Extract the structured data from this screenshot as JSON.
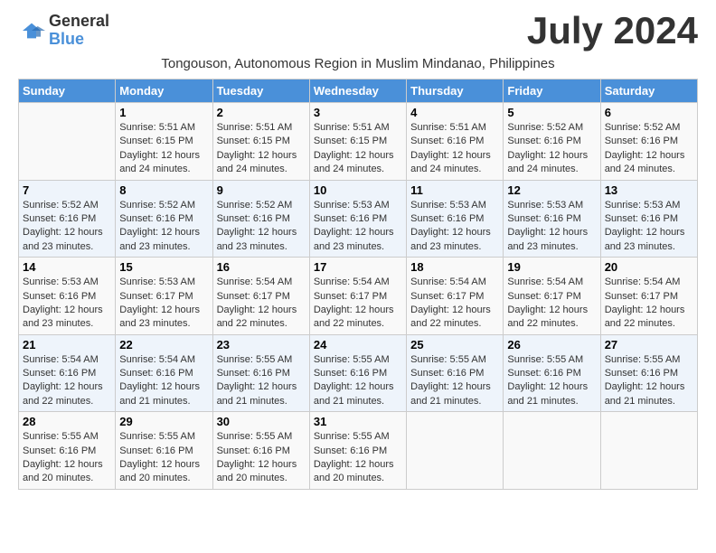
{
  "logo": {
    "line1": "General",
    "line2": "Blue"
  },
  "title": "July 2024",
  "subtitle": "Tongouson, Autonomous Region in Muslim Mindanao, Philippines",
  "days_of_week": [
    "Sunday",
    "Monday",
    "Tuesday",
    "Wednesday",
    "Thursday",
    "Friday",
    "Saturday"
  ],
  "weeks": [
    [
      {
        "num": "",
        "sunrise": "",
        "sunset": "",
        "daylight": ""
      },
      {
        "num": "1",
        "sunrise": "Sunrise: 5:51 AM",
        "sunset": "Sunset: 6:15 PM",
        "daylight": "Daylight: 12 hours and 24 minutes."
      },
      {
        "num": "2",
        "sunrise": "Sunrise: 5:51 AM",
        "sunset": "Sunset: 6:15 PM",
        "daylight": "Daylight: 12 hours and 24 minutes."
      },
      {
        "num": "3",
        "sunrise": "Sunrise: 5:51 AM",
        "sunset": "Sunset: 6:15 PM",
        "daylight": "Daylight: 12 hours and 24 minutes."
      },
      {
        "num": "4",
        "sunrise": "Sunrise: 5:51 AM",
        "sunset": "Sunset: 6:16 PM",
        "daylight": "Daylight: 12 hours and 24 minutes."
      },
      {
        "num": "5",
        "sunrise": "Sunrise: 5:52 AM",
        "sunset": "Sunset: 6:16 PM",
        "daylight": "Daylight: 12 hours and 24 minutes."
      },
      {
        "num": "6",
        "sunrise": "Sunrise: 5:52 AM",
        "sunset": "Sunset: 6:16 PM",
        "daylight": "Daylight: 12 hours and 24 minutes."
      }
    ],
    [
      {
        "num": "7",
        "sunrise": "Sunrise: 5:52 AM",
        "sunset": "Sunset: 6:16 PM",
        "daylight": "Daylight: 12 hours and 23 minutes."
      },
      {
        "num": "8",
        "sunrise": "Sunrise: 5:52 AM",
        "sunset": "Sunset: 6:16 PM",
        "daylight": "Daylight: 12 hours and 23 minutes."
      },
      {
        "num": "9",
        "sunrise": "Sunrise: 5:52 AM",
        "sunset": "Sunset: 6:16 PM",
        "daylight": "Daylight: 12 hours and 23 minutes."
      },
      {
        "num": "10",
        "sunrise": "Sunrise: 5:53 AM",
        "sunset": "Sunset: 6:16 PM",
        "daylight": "Daylight: 12 hours and 23 minutes."
      },
      {
        "num": "11",
        "sunrise": "Sunrise: 5:53 AM",
        "sunset": "Sunset: 6:16 PM",
        "daylight": "Daylight: 12 hours and 23 minutes."
      },
      {
        "num": "12",
        "sunrise": "Sunrise: 5:53 AM",
        "sunset": "Sunset: 6:16 PM",
        "daylight": "Daylight: 12 hours and 23 minutes."
      },
      {
        "num": "13",
        "sunrise": "Sunrise: 5:53 AM",
        "sunset": "Sunset: 6:16 PM",
        "daylight": "Daylight: 12 hours and 23 minutes."
      }
    ],
    [
      {
        "num": "14",
        "sunrise": "Sunrise: 5:53 AM",
        "sunset": "Sunset: 6:16 PM",
        "daylight": "Daylight: 12 hours and 23 minutes."
      },
      {
        "num": "15",
        "sunrise": "Sunrise: 5:53 AM",
        "sunset": "Sunset: 6:17 PM",
        "daylight": "Daylight: 12 hours and 23 minutes."
      },
      {
        "num": "16",
        "sunrise": "Sunrise: 5:54 AM",
        "sunset": "Sunset: 6:17 PM",
        "daylight": "Daylight: 12 hours and 22 minutes."
      },
      {
        "num": "17",
        "sunrise": "Sunrise: 5:54 AM",
        "sunset": "Sunset: 6:17 PM",
        "daylight": "Daylight: 12 hours and 22 minutes."
      },
      {
        "num": "18",
        "sunrise": "Sunrise: 5:54 AM",
        "sunset": "Sunset: 6:17 PM",
        "daylight": "Daylight: 12 hours and 22 minutes."
      },
      {
        "num": "19",
        "sunrise": "Sunrise: 5:54 AM",
        "sunset": "Sunset: 6:17 PM",
        "daylight": "Daylight: 12 hours and 22 minutes."
      },
      {
        "num": "20",
        "sunrise": "Sunrise: 5:54 AM",
        "sunset": "Sunset: 6:17 PM",
        "daylight": "Daylight: 12 hours and 22 minutes."
      }
    ],
    [
      {
        "num": "21",
        "sunrise": "Sunrise: 5:54 AM",
        "sunset": "Sunset: 6:16 PM",
        "daylight": "Daylight: 12 hours and 22 minutes."
      },
      {
        "num": "22",
        "sunrise": "Sunrise: 5:54 AM",
        "sunset": "Sunset: 6:16 PM",
        "daylight": "Daylight: 12 hours and 21 minutes."
      },
      {
        "num": "23",
        "sunrise": "Sunrise: 5:55 AM",
        "sunset": "Sunset: 6:16 PM",
        "daylight": "Daylight: 12 hours and 21 minutes."
      },
      {
        "num": "24",
        "sunrise": "Sunrise: 5:55 AM",
        "sunset": "Sunset: 6:16 PM",
        "daylight": "Daylight: 12 hours and 21 minutes."
      },
      {
        "num": "25",
        "sunrise": "Sunrise: 5:55 AM",
        "sunset": "Sunset: 6:16 PM",
        "daylight": "Daylight: 12 hours and 21 minutes."
      },
      {
        "num": "26",
        "sunrise": "Sunrise: 5:55 AM",
        "sunset": "Sunset: 6:16 PM",
        "daylight": "Daylight: 12 hours and 21 minutes."
      },
      {
        "num": "27",
        "sunrise": "Sunrise: 5:55 AM",
        "sunset": "Sunset: 6:16 PM",
        "daylight": "Daylight: 12 hours and 21 minutes."
      }
    ],
    [
      {
        "num": "28",
        "sunrise": "Sunrise: 5:55 AM",
        "sunset": "Sunset: 6:16 PM",
        "daylight": "Daylight: 12 hours and 20 minutes."
      },
      {
        "num": "29",
        "sunrise": "Sunrise: 5:55 AM",
        "sunset": "Sunset: 6:16 PM",
        "daylight": "Daylight: 12 hours and 20 minutes."
      },
      {
        "num": "30",
        "sunrise": "Sunrise: 5:55 AM",
        "sunset": "Sunset: 6:16 PM",
        "daylight": "Daylight: 12 hours and 20 minutes."
      },
      {
        "num": "31",
        "sunrise": "Sunrise: 5:55 AM",
        "sunset": "Sunset: 6:16 PM",
        "daylight": "Daylight: 12 hours and 20 minutes."
      },
      {
        "num": "",
        "sunrise": "",
        "sunset": "",
        "daylight": ""
      },
      {
        "num": "",
        "sunrise": "",
        "sunset": "",
        "daylight": ""
      },
      {
        "num": "",
        "sunrise": "",
        "sunset": "",
        "daylight": ""
      }
    ]
  ]
}
